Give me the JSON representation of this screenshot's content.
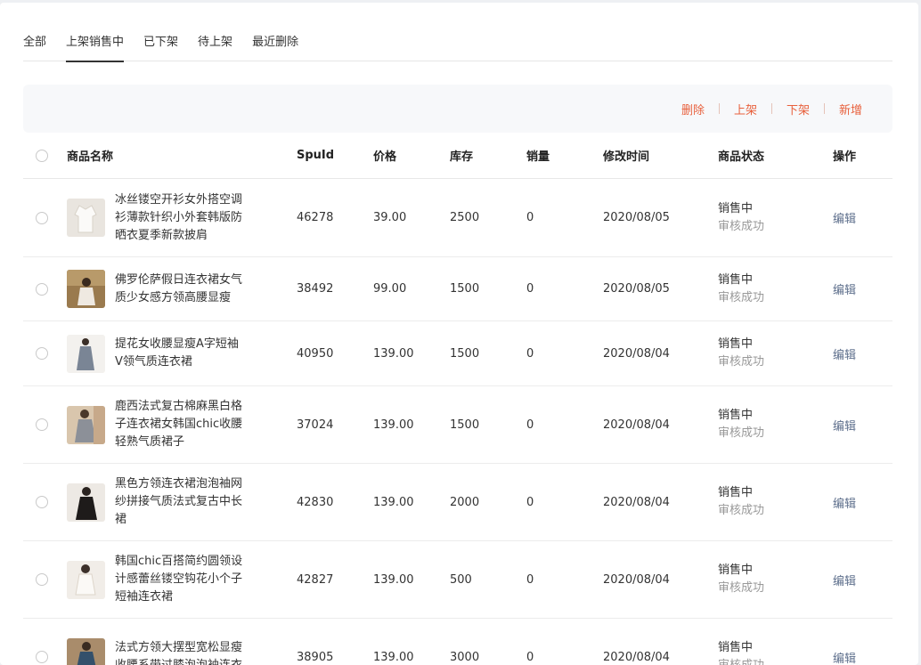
{
  "tabs": [
    {
      "label": "全部"
    },
    {
      "label": "上架销售中"
    },
    {
      "label": "已下架"
    },
    {
      "label": "待上架"
    },
    {
      "label": "最近删除"
    }
  ],
  "toolbar": {
    "delete": "删除",
    "on_shelf": "上架",
    "off_shelf": "下架",
    "add": "新增"
  },
  "table": {
    "headers": {
      "name": "商品名称",
      "spu": "SpuId",
      "price": "价格",
      "stock": "库存",
      "sales": "销量",
      "time": "修改时间",
      "status": "商品状态",
      "op": "操作"
    },
    "rows": [
      {
        "name": "冰丝镂空开衫女外搭空调衫薄款针织小外套韩版防晒衣夏季新款披肩",
        "spu": "46278",
        "price": "39.00",
        "stock": "2500",
        "sales": "0",
        "time": "2020/08/05",
        "status": "销售中",
        "audit": "审核成功",
        "op": "编辑"
      },
      {
        "name": "佛罗伦萨假日连衣裙女气质少女感方领高腰显瘦",
        "spu": "38492",
        "price": "99.00",
        "stock": "1500",
        "sales": "0",
        "time": "2020/08/05",
        "status": "销售中",
        "audit": "审核成功",
        "op": "编辑"
      },
      {
        "name": "提花女收腰显瘦A字短袖V领气质连衣裙",
        "spu": "40950",
        "price": "139.00",
        "stock": "1500",
        "sales": "0",
        "time": "2020/08/04",
        "status": "销售中",
        "audit": "审核成功",
        "op": "编辑"
      },
      {
        "name": "鹿西法式复古棉麻黑白格子连衣裙女韩国chic收腰轻熟气质裙子",
        "spu": "37024",
        "price": "139.00",
        "stock": "1500",
        "sales": "0",
        "time": "2020/08/04",
        "status": "销售中",
        "audit": "审核成功",
        "op": "编辑"
      },
      {
        "name": "黑色方领连衣裙泡泡袖网纱拼接气质法式复古中长裙",
        "spu": "42830",
        "price": "139.00",
        "stock": "2000",
        "sales": "0",
        "time": "2020/08/04",
        "status": "销售中",
        "audit": "审核成功",
        "op": "编辑"
      },
      {
        "name": "韩国chic百搭简约圆领设计感蕾丝镂空钩花小个子短袖连衣裙",
        "spu": "42827",
        "price": "139.00",
        "stock": "500",
        "sales": "0",
        "time": "2020/08/04",
        "status": "销售中",
        "audit": "审核成功",
        "op": "编辑"
      },
      {
        "name": "法式方领大摆型宽松显瘦收腰系带过膝泡泡袖连衣",
        "spu": "38905",
        "price": "139.00",
        "stock": "3000",
        "sales": "0",
        "time": "2020/08/04",
        "status": "销售中",
        "audit": "审核成功",
        "op": "编辑"
      }
    ]
  },
  "colors": {
    "accent": "#e8603c",
    "link": "#5e6f8c"
  }
}
